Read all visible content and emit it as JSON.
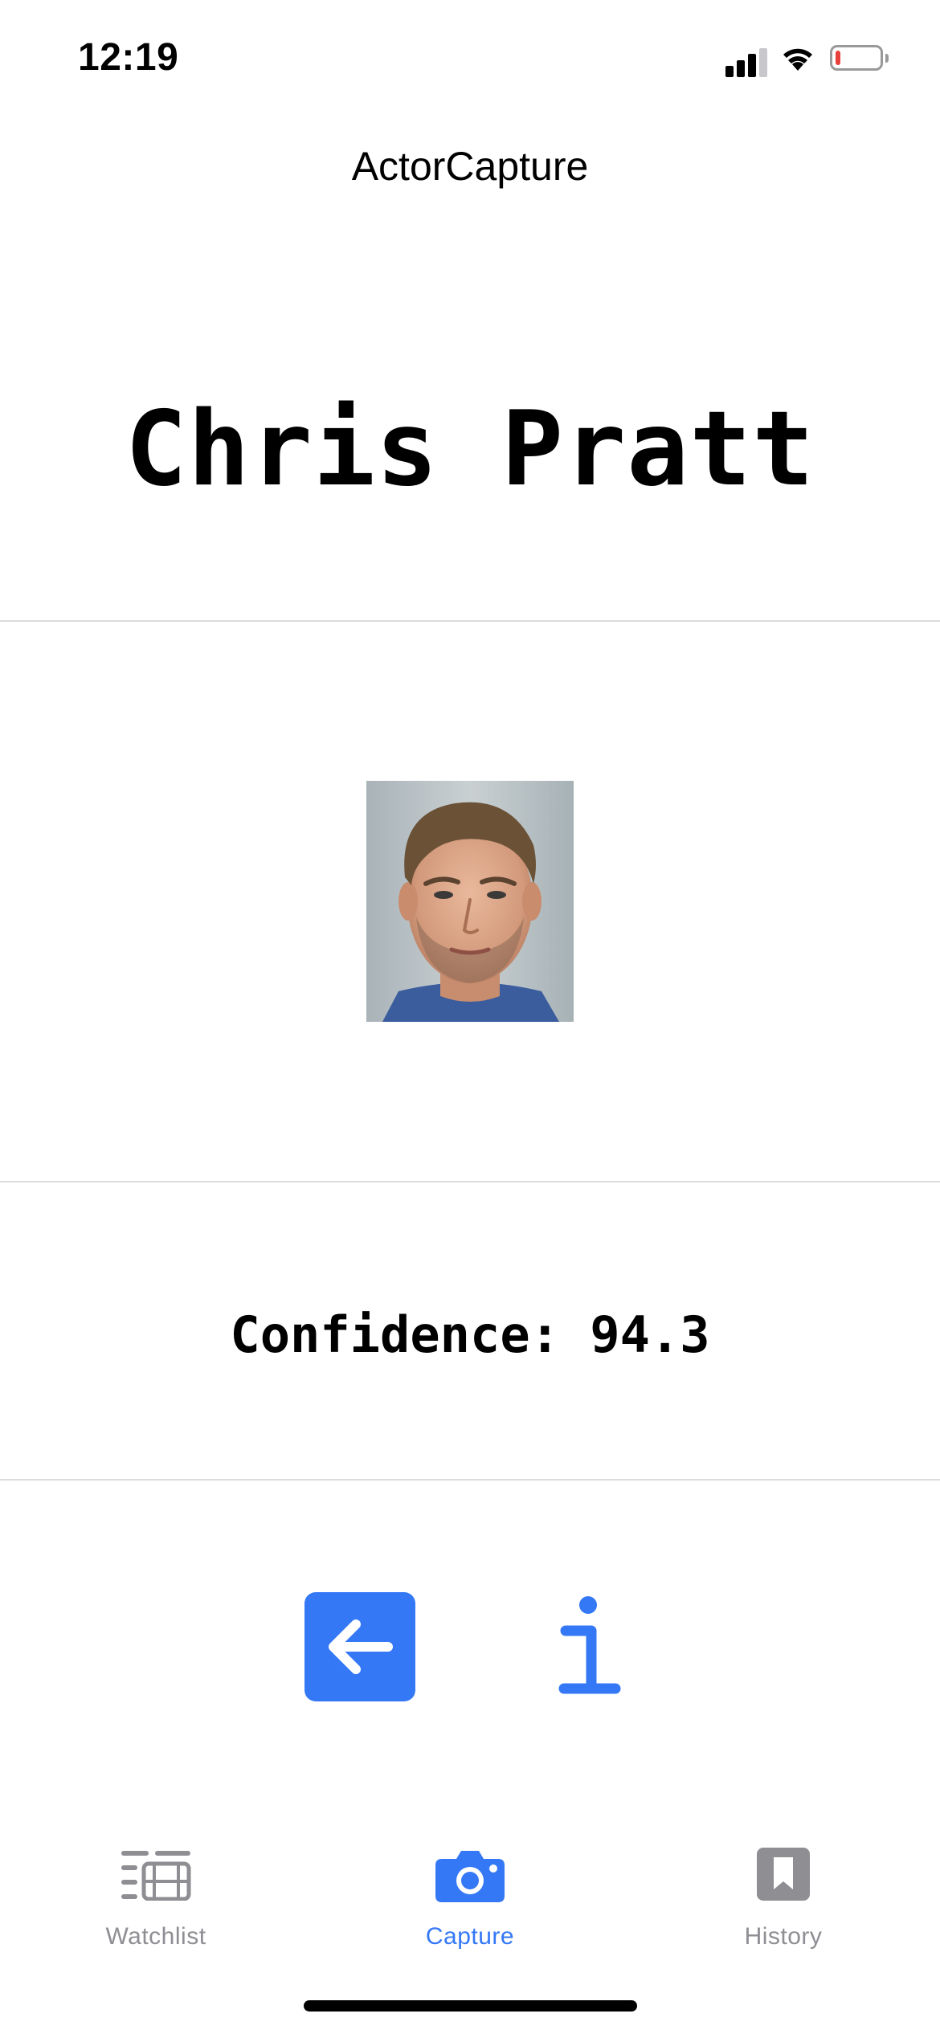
{
  "status_bar": {
    "time": "12:19",
    "battery_level": 0.12,
    "battery_color": "#e8403a"
  },
  "nav": {
    "title": "ActorCapture"
  },
  "result": {
    "actor_name": "Chris Pratt",
    "confidence_text": "Confidence: 94.3"
  },
  "actions": {
    "back_icon": "arrow-left-icon",
    "info_icon": "info-icon"
  },
  "tabs": [
    {
      "label": "Watchlist",
      "icon": "film-list-icon",
      "active": false
    },
    {
      "label": "Capture",
      "icon": "camera-icon",
      "active": true
    },
    {
      "label": "History",
      "icon": "bookmark-icon",
      "active": false
    }
  ],
  "colors": {
    "accent": "#3478f6",
    "inactive": "#8e8e93",
    "divider": "#dcdcdc"
  }
}
